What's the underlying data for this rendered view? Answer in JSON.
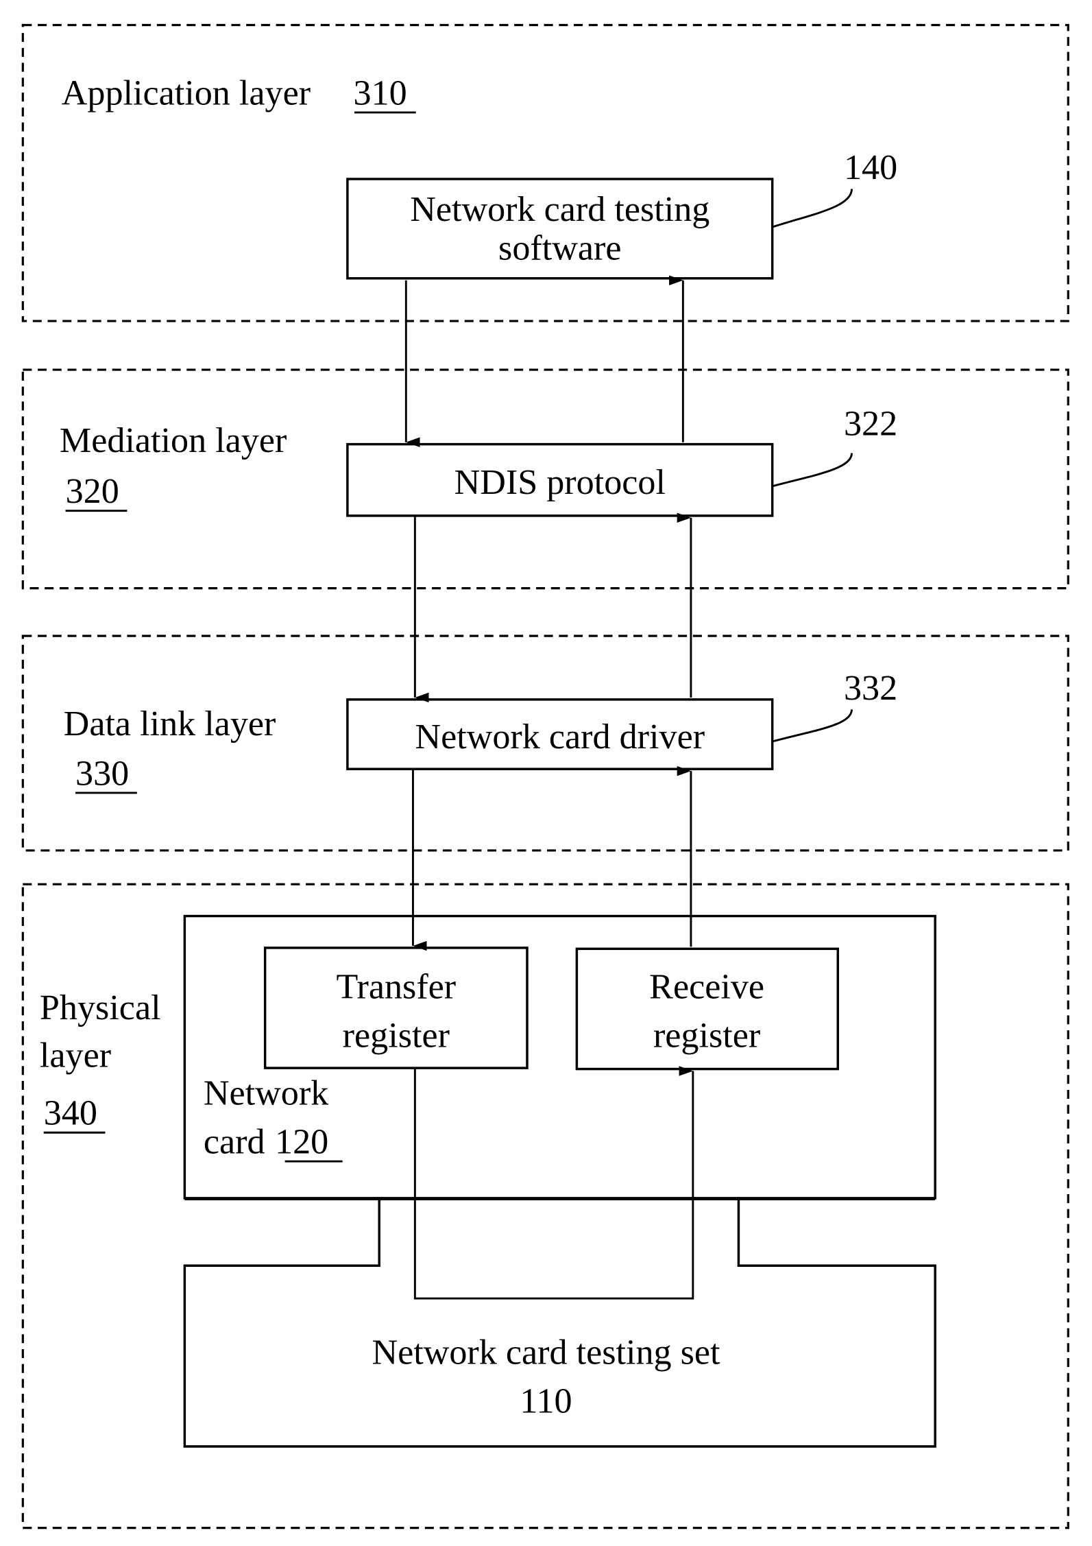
{
  "layers": {
    "application": {
      "name": "Application layer",
      "ref": "310"
    },
    "mediation": {
      "name": "Mediation layer",
      "ref": "320"
    },
    "datalink": {
      "name": "Data link layer",
      "ref": "330"
    },
    "physical": {
      "line1": "Physical",
      "line2": "layer",
      "ref": "340"
    }
  },
  "blocks": {
    "software": {
      "line1": "Network card testing",
      "line2": "software",
      "ref": "140"
    },
    "ndis": {
      "label": "NDIS protocol",
      "ref": "322"
    },
    "driver": {
      "label": "Network card driver",
      "ref": "332"
    },
    "transfer": {
      "line1": "Transfer",
      "line2": "register"
    },
    "receive": {
      "line1": "Receive",
      "line2": "register"
    },
    "card": {
      "line1": "Network",
      "line2_prefix": "card",
      "ref": "120"
    },
    "testing_set": {
      "line1": "Network card testing set",
      "line2": "110"
    }
  }
}
